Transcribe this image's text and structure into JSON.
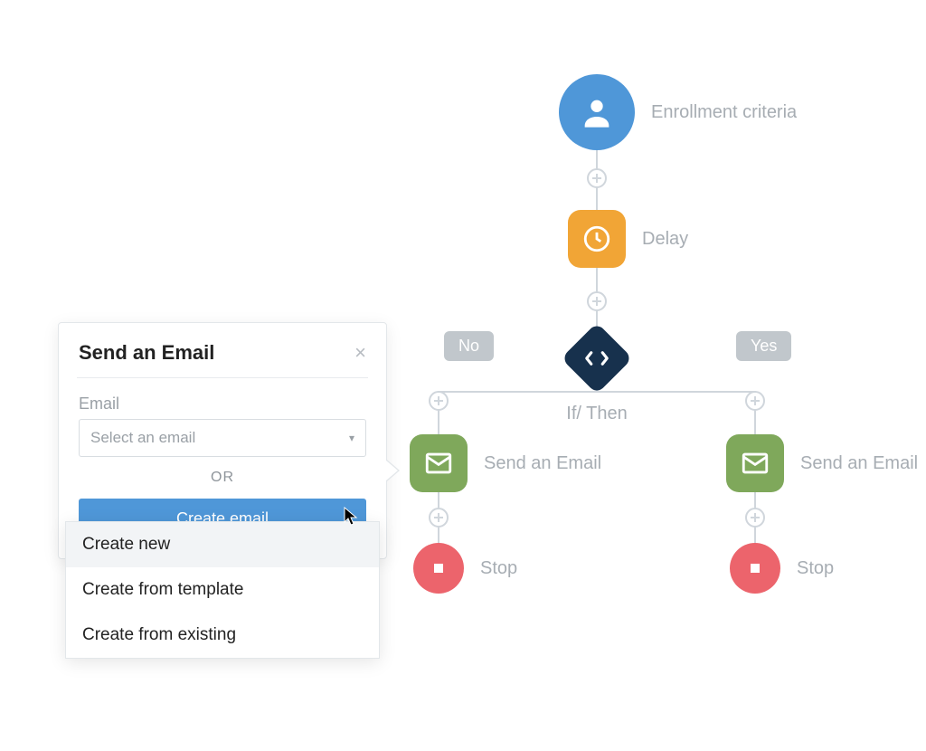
{
  "workflow": {
    "enrollment_label": "Enrollment criteria",
    "delay_label": "Delay",
    "ifthen_label": "If/ Then",
    "branch_no": "No",
    "branch_yes": "Yes",
    "send_email_label": "Send an Email",
    "stop_label": "Stop"
  },
  "panel": {
    "title": "Send an Email",
    "field_label": "Email",
    "select_placeholder": "Select an email",
    "or_text": "OR",
    "create_button": "Create email",
    "options": {
      "create_new": "Create new",
      "create_from_template": "Create from template",
      "create_from_existing": "Create from existing"
    }
  },
  "colors": {
    "blue": "#4f97d8",
    "amber": "#f1a536",
    "navy": "#17314d",
    "green": "#7fa85b",
    "red": "#ec646c",
    "grey_line": "#d0d6dc",
    "grey_text": "#a7adb3",
    "tag_bg": "#c1c7cc"
  }
}
